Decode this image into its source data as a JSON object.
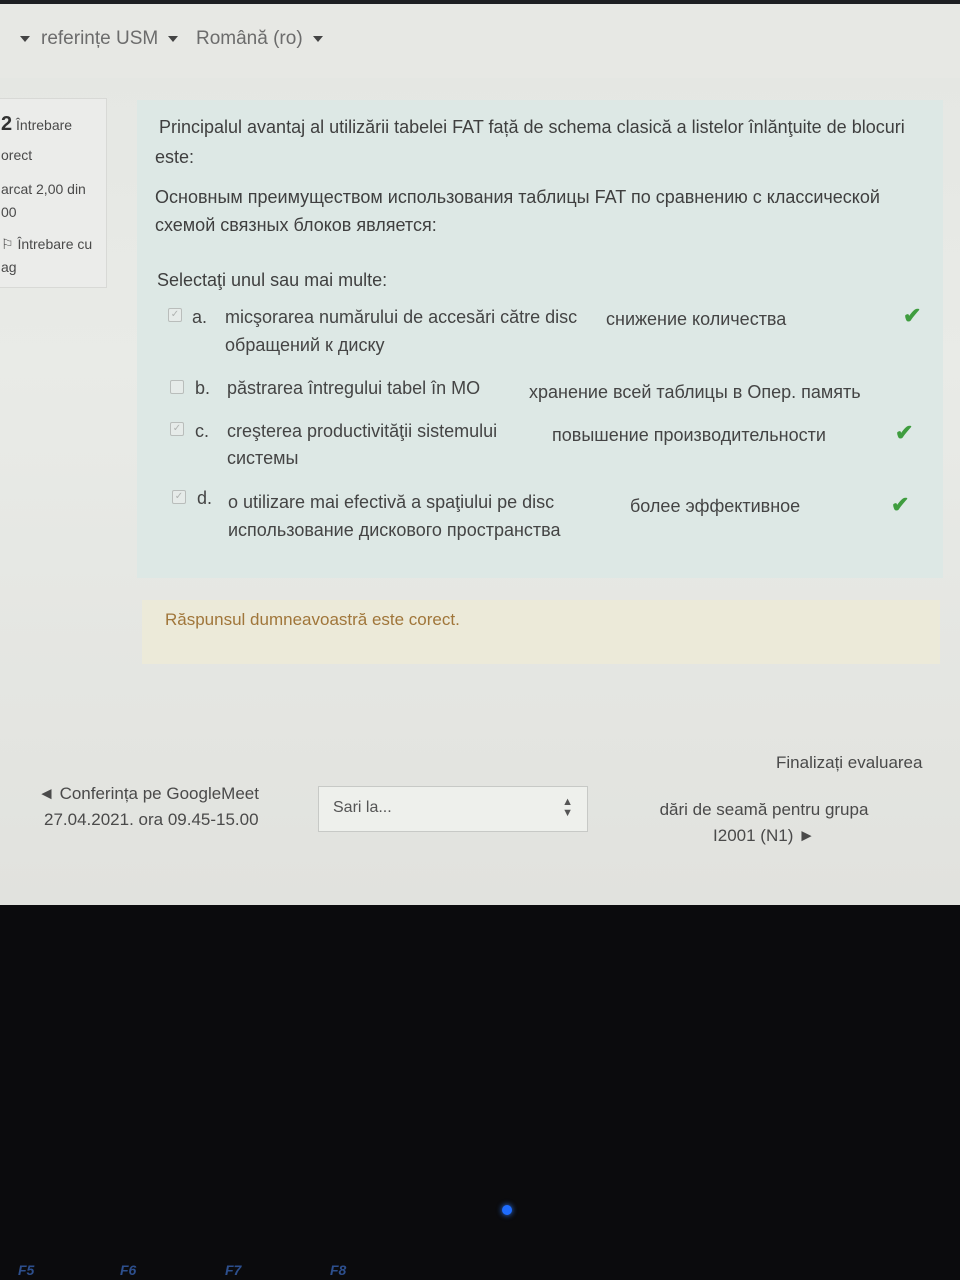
{
  "nav": {
    "items": [
      {
        "label": "referințe USM"
      },
      {
        "label": "Română (ro)"
      }
    ]
  },
  "info": {
    "number": "2",
    "label": "Întrebare",
    "status": "orect",
    "mark_line1": "arcat 2,00 din",
    "mark_line2": "00",
    "flag_line1": "Întrebare cu",
    "flag_line2": "ag"
  },
  "question": {
    "text_ro_line1": "Principalul avantaj al utilizării tabelei FAT față de schema clasică a listelor înlănţuite de blocuri",
    "text_ro_line2": "este:",
    "text_ru_line1": "Основным преимуществом использования таблицы FAT по сравнению с классической",
    "text_ru_line2": "схемой связных блоков является:",
    "prompt": "Selectaţi unul sau mai multe:",
    "options": [
      {
        "letter": "a.",
        "ro": "micşorarea numărului de accesări către disc",
        "ru1": "снижение количества",
        "ru2": "обращений к диску",
        "checked": true,
        "correct": true
      },
      {
        "letter": "b.",
        "ro": "păstrarea întregului tabel în MO",
        "ru1": "хранение всей таблицы в Опер. память",
        "ru2": "",
        "checked": false,
        "correct": false
      },
      {
        "letter": "c.",
        "ro": "creşterea productivităţii sistemului",
        "ru1": "повышение производительности",
        "ru2": "системы",
        "checked": true,
        "correct": true
      },
      {
        "letter": "d.",
        "ro": "o utilizare mai efectivă a spaţiului pe disc",
        "ru1": "более эффективное",
        "ru2": "использование дискового пространства",
        "checked": true,
        "correct": true
      }
    ]
  },
  "feedback": {
    "text": "Răspunsul dumneavoastră este corect."
  },
  "footer": {
    "finish": "Finalizați evaluarea",
    "prev_line1": "Conferința pe GoogleMeet",
    "prev_line2": "27.04.2021.  ora 09.45-15.00",
    "jump_placeholder": "Sari la...",
    "next_line1": "dări de seamă pentru grupa",
    "next_line2": "I2001 (N1)"
  },
  "keyboard": {
    "keys": [
      "F5",
      "F6",
      "F7",
      "F8"
    ]
  },
  "colors": {
    "correct": "#3f9d3f",
    "feedback_text": "#a0763a",
    "question_bg": "#dde8e5",
    "led": "#1e6cff"
  }
}
